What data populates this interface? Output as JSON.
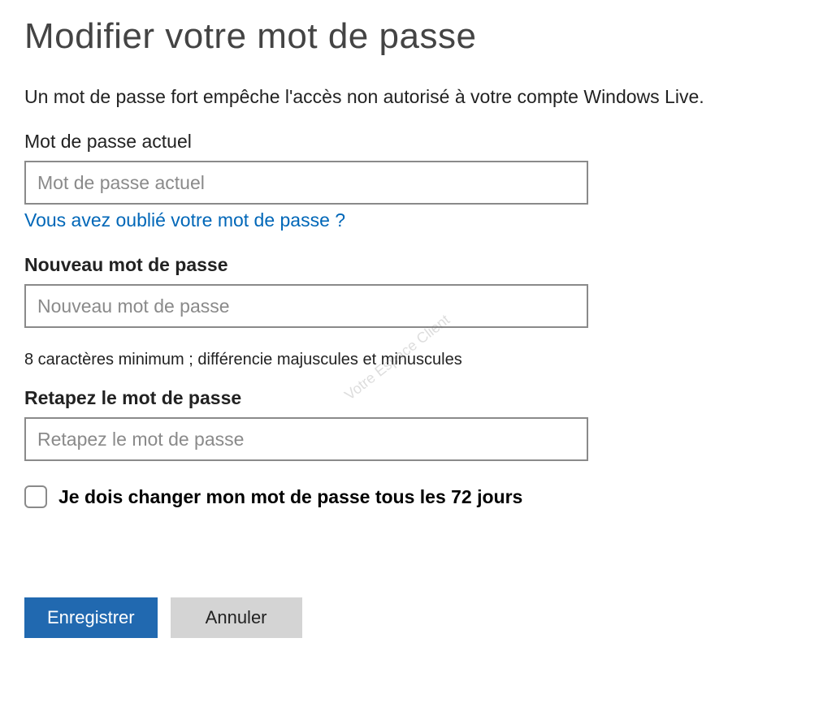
{
  "title": "Modifier votre mot de passe",
  "description": "Un mot de passe fort empêche l'accès non autorisé à votre compte Windows Live.",
  "current": {
    "label": "Mot de passe actuel",
    "placeholder": "Mot de passe actuel"
  },
  "forgot_link": "Vous avez oublié votre mot de passe ?",
  "new": {
    "label": "Nouveau mot de passe",
    "placeholder": "Nouveau mot de passe"
  },
  "hint": "8 caractères minimum ; différencie majuscules et minuscules",
  "retype": {
    "label": "Retapez le mot de passe",
    "placeholder": "Retapez le mot de passe"
  },
  "checkbox_label": "Je dois changer mon mot de passe tous les 72 jours",
  "buttons": {
    "save": "Enregistrer",
    "cancel": "Annuler"
  },
  "watermark": "Votre Espace Client"
}
